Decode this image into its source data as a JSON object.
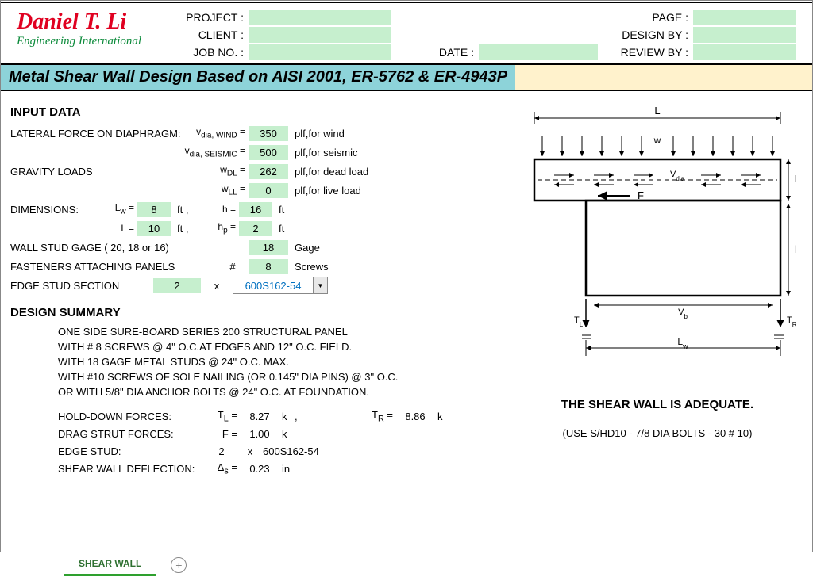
{
  "logo": {
    "name": "Daniel T. Li",
    "sub": "Engineering International"
  },
  "header": {
    "project": "PROJECT :",
    "client": "CLIENT :",
    "jobno": "JOB NO. :",
    "date": "DATE :",
    "page": "PAGE :",
    "designby": "DESIGN BY :",
    "reviewby": "REVIEW BY :"
  },
  "title": "Metal Shear Wall Design Based on AISI 2001, ER-5762 & ER-4943P",
  "sections": {
    "input": "INPUT DATA",
    "summary": "DESIGN SUMMARY"
  },
  "input": {
    "lateral_label": "LATERAL FORCE ON DIAPHRAGM:",
    "vdia_wind_var": "dia, WIND",
    "vdia_wind_val": "350",
    "vdia_wind_unit": "plf,for wind",
    "vdia_seis_var": "dia, SEISMIC",
    "vdia_seis_val": "500",
    "vdia_seis_unit": "plf,for seismic",
    "gravity_label": "GRAVITY LOADS",
    "wdl_var": "DL",
    "wdl_val": "262",
    "wdl_unit": "plf,for dead load",
    "wll_var": "LL",
    "wll_val": "0",
    "wll_unit": "plf,for live load",
    "dim_label": "DIMENSIONS:",
    "lw_var": "Lw =",
    "lw_val": "8",
    "ft": "ft",
    "h_var": "h  =",
    "h_val": "16",
    "l_var": "L  =",
    "l_val": "10",
    "hp_var": "hp =",
    "hp_val": "2",
    "stud_label": "WALL STUD GAGE ( 20, 18 or 16)",
    "stud_val": "18",
    "stud_unit": "Gage",
    "fast_label": "FASTENERS ATTACHING PANELS",
    "fast_hash": "#",
    "fast_val": "8",
    "fast_unit": "Screws",
    "edge_label": "EDGE STUD SECTION",
    "edge_val": "2",
    "edge_x": "x",
    "edge_section": "600S162-54"
  },
  "summary": {
    "l1": "ONE SIDE SURE-BOARD SERIES 200 STRUCTURAL PANEL",
    "l2": "WITH # 8 SCREWS @ 4\" O.C.AT EDGES AND 12\" O.C. FIELD.",
    "l3": "WITH 18 GAGE METAL STUDS @ 24\" O.C. MAX.",
    "l4": "WITH #10 SCREWS OF SOLE NAILING (OR 0.145\" DIA PINS) @ 3\" O.C.",
    "l5": "OR WITH 5/8\" DIA ANCHOR BOLTS @ 24\" O.C. AT FOUNDATION.",
    "hd_label": "HOLD-DOWN FORCES:",
    "tl_var": "TL =",
    "tl_val": "8.27",
    "k": "k",
    "comma": ",",
    "tr_var": "TR =",
    "tr_val": "8.86",
    "hd_note": "(USE S/HD10 - 7/8 DIA BOLTS - 30 # 10)",
    "drag_label": "DRAG STRUT FORCES:",
    "f_var": "F  =",
    "f_val": "1.00",
    "es_label": "EDGE STUD:",
    "es_qty": "2",
    "es_x": "x",
    "es_sec": "600S162-54",
    "defl_label": "SHEAR WALL DEFLECTION:",
    "defl_var": "Δs  =",
    "defl_val": "0.23",
    "defl_unit": "in"
  },
  "diagram": {
    "L": "L",
    "w": "w",
    "Vdia": "Vdia",
    "hp": "hp",
    "F": "F",
    "h": "h",
    "TL": "TL",
    "TR": "TR",
    "Vb": "Vb",
    "Lw": "Lw"
  },
  "adequate": "THE SHEAR WALL IS ADEQUATE.",
  "tabs": {
    "shearwall": "SHEAR WALL"
  }
}
